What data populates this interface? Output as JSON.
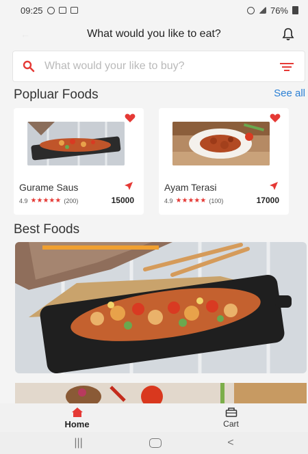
{
  "status_bar": {
    "time": "09:25",
    "battery": "76%"
  },
  "app_bar": {
    "title": "What would you like to eat?"
  },
  "search": {
    "placeholder": "What would your like to buy?"
  },
  "popular": {
    "title": "Popluar Foods",
    "see_all": "See all",
    "items": [
      {
        "name": "Gurame Saus",
        "rating": "4.9",
        "stars": "★★★★★",
        "reviews": "(200)",
        "price": "15000"
      },
      {
        "name": "Ayam Terasi",
        "rating": "4.9",
        "stars": "★★★★★",
        "reviews": "(100)",
        "price": "17000"
      }
    ]
  },
  "best": {
    "title": "Best Foods"
  },
  "bottom_nav": {
    "home": "Home",
    "cart": "Cart"
  },
  "colors": {
    "accent": "#e53935",
    "link": "#2a7fd4"
  },
  "icons": [
    "bell-icon",
    "search-icon",
    "filter-icon",
    "heart-icon",
    "navigation-icon",
    "home-icon",
    "cart-icon"
  ]
}
